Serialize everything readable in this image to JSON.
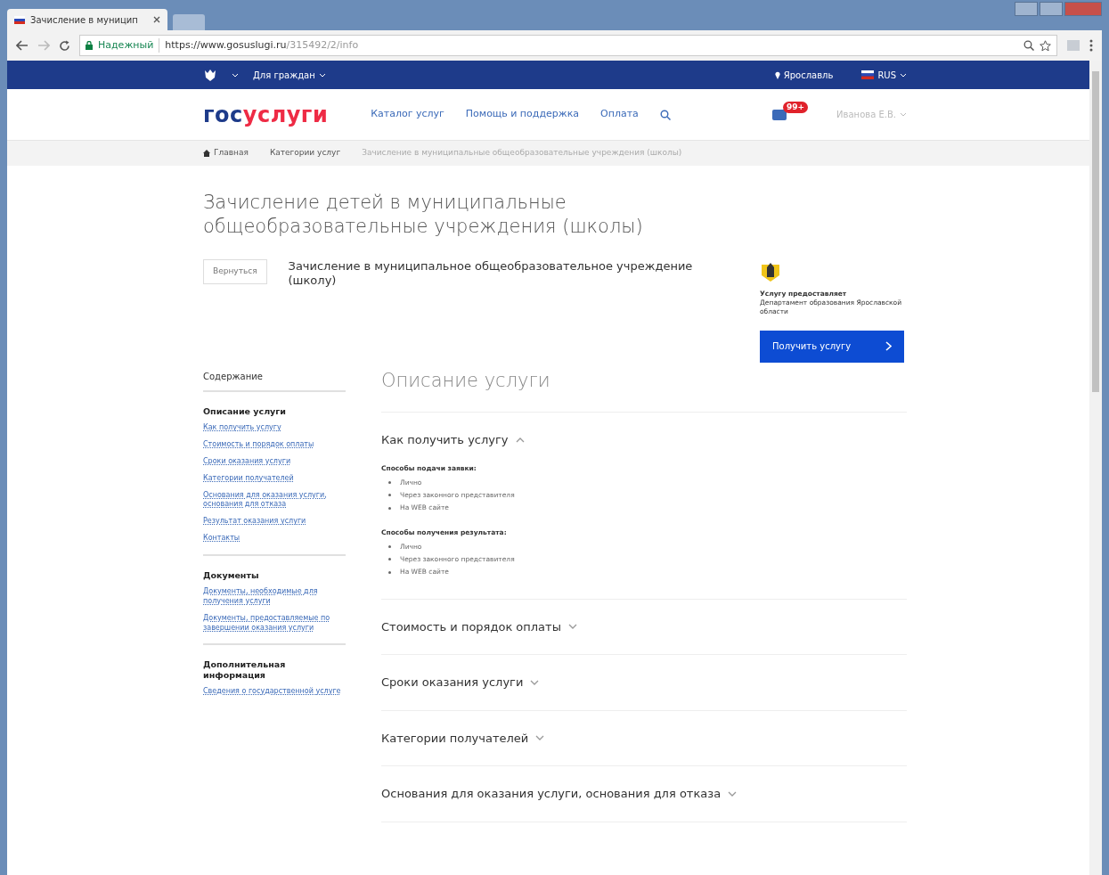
{
  "browser": {
    "tab_title": "Зачисление в муницип",
    "secure_label": "Надежный",
    "url_host": "https://www.gosuslugi.ru",
    "url_path": "/315492/2/info"
  },
  "top_bar": {
    "audience": "Для граждан",
    "city": "Ярославль",
    "language": "RUS"
  },
  "header": {
    "logo_prefix": "гос",
    "logo_suffix": "услуги",
    "nav": [
      "Каталог услуг",
      "Помощь и поддержка",
      "Оплата"
    ],
    "notifications": "99+",
    "user": "Иванова Е.В."
  },
  "breadcrumbs": [
    "Главная",
    "Категории услуг",
    "Зачисление в муниципальные общеобразовательные учреждения (школы)"
  ],
  "title": "Зачисление детей в муниципальные общеобразовательные учреждения (школы)",
  "back_button": "Вернуться",
  "service_name": "Зачисление в муниципальное общеобразовательное учреждение (школу)",
  "provider": {
    "label": "Услугу предоставляет",
    "name": "Департамент образования Ярославской области"
  },
  "get_service_button": "Получить услугу",
  "sidebar": {
    "heading": "Содержание",
    "sections": [
      {
        "title": "Описание услуги",
        "links": [
          "Как получить услугу",
          "Стоимость и порядок оплаты",
          "Сроки оказания услуги",
          "Категории получателей",
          "Основания для оказания услуги, основания для отказа",
          "Результат оказания услуги",
          "Контакты"
        ]
      },
      {
        "title": "Документы",
        "links": [
          "Документы, необходимые для получения услуги",
          "Документы, предоставляемые по завершении оказания услуги"
        ]
      },
      {
        "title": "Дополнительная информация",
        "links": [
          "Сведения о государственной услуге"
        ]
      }
    ]
  },
  "main": {
    "heading": "Описание услуги",
    "sections": [
      {
        "title": "Как получить услугу",
        "expanded": true,
        "groups": [
          {
            "title": "Способы подачи заявки:",
            "items": [
              "Лично",
              "Через законного представителя",
              "На WEB сайте"
            ]
          },
          {
            "title": "Способы получения результата:",
            "items": [
              "Лично",
              "Через законного представителя",
              "На WEB сайте"
            ]
          }
        ]
      },
      {
        "title": "Стоимость и порядок оплаты",
        "expanded": false
      },
      {
        "title": "Сроки оказания услуги",
        "expanded": false
      },
      {
        "title": "Категории получателей",
        "expanded": false
      },
      {
        "title": "Основания для оказания услуги, основания для отказа",
        "expanded": false
      }
    ]
  }
}
